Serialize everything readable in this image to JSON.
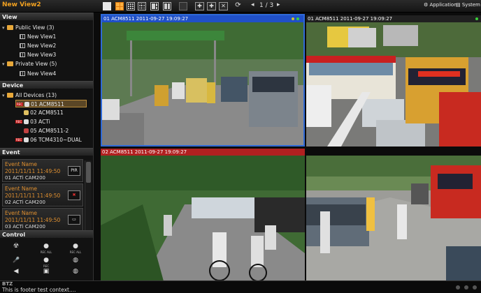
{
  "app": {
    "title": "New View2"
  },
  "toolbar": {
    "page_indicator": "1 / 3",
    "prev_label": "◂",
    "next_label": "▸",
    "application_label": "Application",
    "system_log_label": "System Lo",
    "tools": [
      "✚",
      "✚",
      "✕"
    ]
  },
  "sections": {
    "view": "View",
    "device": "Device",
    "event": "Event",
    "control": "Control"
  },
  "views": [
    {
      "label": "Public View (3)",
      "type": "folder"
    },
    {
      "label": "New View1",
      "type": "view"
    },
    {
      "label": "New View2",
      "type": "view"
    },
    {
      "label": "New View3",
      "type": "view"
    },
    {
      "label": "Private View (5)",
      "type": "folder"
    },
    {
      "label": "New View4",
      "type": "view"
    }
  ],
  "devices": [
    {
      "label": "All Devices (13)",
      "type": "folder"
    },
    {
      "label": "01 ACM8511",
      "type": "cam",
      "selected": true
    },
    {
      "label": "02 ACM8511",
      "type": "cam"
    },
    {
      "label": "03 ACTi",
      "type": "cam"
    },
    {
      "label": "05 ACM8511-2",
      "type": "cam"
    },
    {
      "label": "06 TCM4310~DUAL",
      "type": "cam"
    }
  ],
  "events": [
    {
      "name": "Event Name",
      "time": "2011/11/11 11:49:50",
      "camera": "01 ACTi CAM200",
      "badge": "PIR"
    },
    {
      "name": "Event Name",
      "time": "2011/11/11 11:49:50",
      "camera": "02 ACTi CAM200",
      "badge": "✖"
    },
    {
      "name": "Event Name",
      "time": "2011/11/11 11:49:50",
      "camera": "03 ACTi CAM200",
      "badge": "▭"
    }
  ],
  "controls": [
    {
      "icon": "☢",
      "label": ""
    },
    {
      "icon": "●",
      "label": "REC ALL"
    },
    {
      "icon": "●",
      "label": "REC ALL"
    },
    {
      "icon": "🎤",
      "label": ""
    },
    {
      "icon": "●",
      "label": "REC"
    },
    {
      "icon": "◍",
      "label": ""
    },
    {
      "icon": "◀",
      "label": ""
    },
    {
      "icon": "▣",
      "label": ""
    },
    {
      "icon": "◍",
      "label": ""
    }
  ],
  "tiles": [
    {
      "label": "01 ACM8511   2011-09-27  19:09:27",
      "bar_color": "#2050c8",
      "selected": true
    },
    {
      "label": "01 ACM8511   2011-09-27  19:09:27",
      "bar_color": "#202020"
    },
    {
      "label": "02 ACM8511   2011-09-27  19:09:27",
      "bar_color": "#b02020"
    },
    {
      "label": "",
      "bar_color": ""
    }
  ],
  "footer": {
    "title": "BTZ",
    "text": "This is footer test context...."
  },
  "colors": {
    "accent": "#e09030",
    "selected_bar": "#2050c8",
    "alert_bar": "#b02020"
  }
}
